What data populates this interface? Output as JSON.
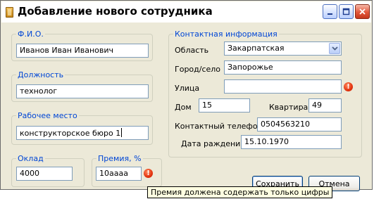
{
  "window": {
    "title": "Добавление нового сотрудника",
    "controls": [
      "minimize-icon",
      "maximize-icon",
      "close-icon"
    ]
  },
  "fio": {
    "legend": "Ф.И.О.",
    "value": "Иванов Иван Иванович"
  },
  "position": {
    "legend": "Должность",
    "value": "технолог"
  },
  "workplace": {
    "legend": "Рабочее место",
    "value": "конструкторское бюро 1"
  },
  "salary": {
    "legend": "Оклад",
    "value": "4000"
  },
  "bonus": {
    "legend": "Премия, %",
    "value": "10аааа",
    "error_icon": "error-icon"
  },
  "contact": {
    "legend": "Контактная информация",
    "region_label": "Область",
    "region_value": "Закарпатская",
    "city_label": "Город/село",
    "city_value": "Запорожье",
    "street_label": "Улица",
    "street_value": "",
    "house_label": "Дом",
    "house_value": "15",
    "apartment_label": "Квартира",
    "apartment_value": "49",
    "phone_label": "Контактный телефон",
    "phone_value": "0504563210",
    "birthdate_label": "Дата раждения",
    "birthdate_value": "15.10.1970"
  },
  "buttons": {
    "save": "Сохранить",
    "cancel": "Отмена"
  },
  "tooltip": "Премия должена содержать только цифры",
  "colors": {
    "legend_text": "#0046d5",
    "window_bg": "#ece9d8",
    "error": "#e3330f",
    "tooltip_bg": "#ffffe1"
  }
}
